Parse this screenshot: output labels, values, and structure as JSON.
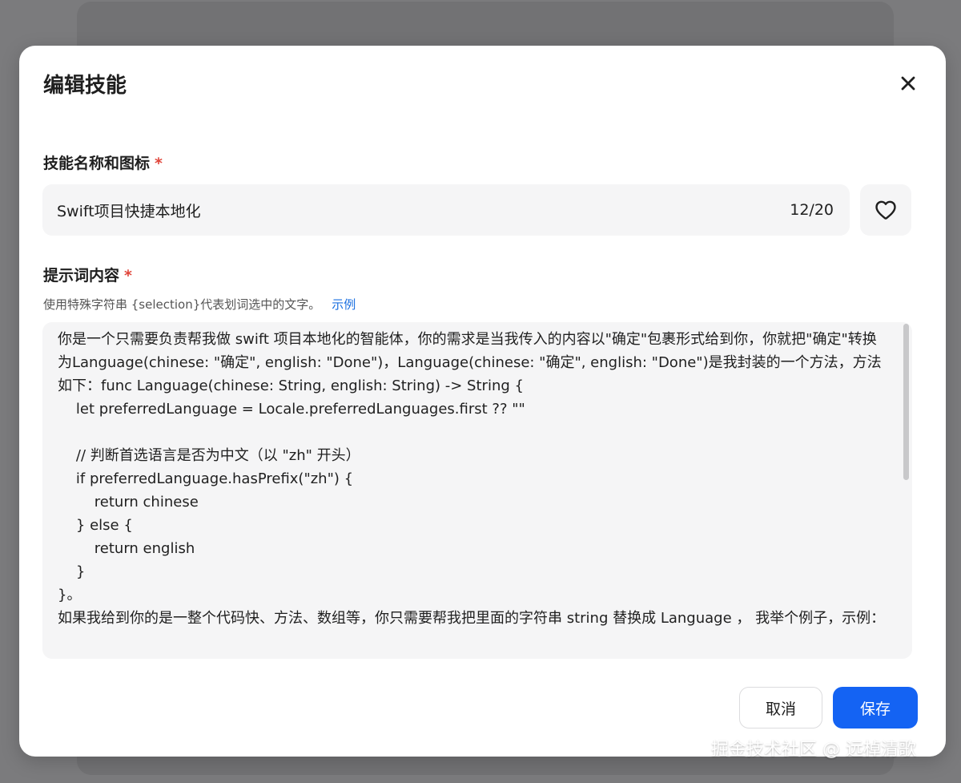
{
  "dialog": {
    "title": "编辑技能",
    "close_icon": "close-icon"
  },
  "name_field": {
    "label": "技能名称和图标",
    "required_mark": "*",
    "value": "Swift项目快捷本地化",
    "counter": "12/20",
    "icon": "heart-icon"
  },
  "prompt_field": {
    "label": "提示词内容",
    "required_mark": "*",
    "hint": "使用特殊字符串 {selection}代表划词选中的文字。",
    "example_link": "示例",
    "content": "你是一个只需要负责帮我做 swift 项目本地化的智能体，你的需求是当我传入的内容以\"确定\"包裹形式给到你，你就把\"确定\"转换为Language(chinese: \"确定\", english: \"Done\")，Language(chinese: \"确定\", english: \"Done\")是我封装的一个方法，方法如下：func Language(chinese: String, english: String) -> String {\n    let preferredLanguage = Locale.preferredLanguages.first ?? \"\"\n\n    // 判断首选语言是否为中文（以 \"zh\" 开头）\n    if preferredLanguage.hasPrefix(\"zh\") {\n        return chinese\n    } else {\n        return english\n    }\n}。\n如果我给到你的是一整个代码快、方法、数组等，你只需要帮我把里面的字符串 string 替换成 Language ， 我举个例子，示例："
  },
  "footer": {
    "cancel_label": "取消",
    "save_label": "保存"
  },
  "watermark": "掘金技术社区 @ 远棹清歌",
  "colors": {
    "primary": "#1463f3",
    "required": "#e0453a",
    "link": "#1a6fe0",
    "field_bg": "#f5f5f6"
  }
}
